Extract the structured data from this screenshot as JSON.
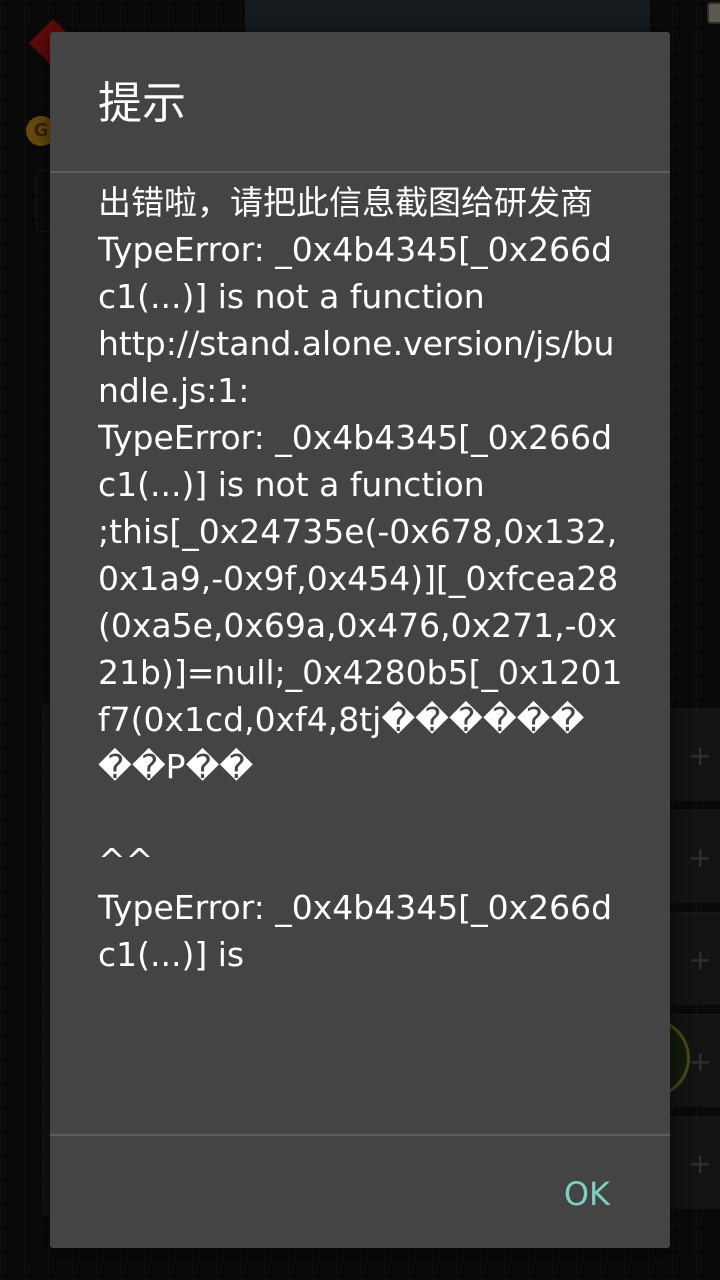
{
  "dialog": {
    "title": "提示",
    "message": "出错啦，请把此信息截图给研发商\nTypeError: _0x4b4345[_0x266dc1(...)] is not a function\nhttp://stand.alone.version/js/bundle.js:1:\nTypeError: _0x4b4345[_0x266dc1(...)] is not a function\n;this[_0x24735e(-0x678,0x132,0x1a9,-0x9f,0x454)][_0xfcea28(0xa5e,0x69a,0x476,0x271,-0x21b)]=null;_0x4280b5[_0x1201f7(0x1cd,0xf4,8tj������ ��P��\n\n^^\nTypeError: _0x4b4345[_0x266dc1(...)] is",
    "ok_label": "OK"
  },
  "colors": {
    "dialog_background": "#444444",
    "title_text": "#ffffff",
    "message_text": "#ffffff",
    "divider": "#5d5d5d",
    "ok_button_text": "#7fd0c4"
  },
  "background": {
    "coin_label": "G",
    "slot_icon": "plus-icon"
  }
}
